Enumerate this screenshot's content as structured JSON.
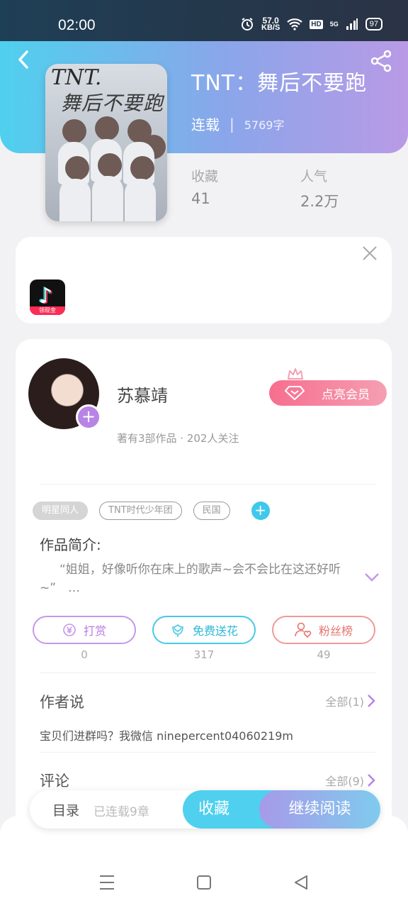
{
  "status_bar": {
    "time": "02:00",
    "speed_value": "57.0",
    "speed_unit": "KB/S",
    "hd": "HD",
    "network": "5G",
    "battery": "97"
  },
  "book": {
    "title": "TNT：舞后不要跑",
    "status": "连载",
    "words": "5769字",
    "cover_text": "TNT.",
    "cover_subtext": "舞后不要跑"
  },
  "stats": {
    "collect_label": "收藏",
    "collect_value": "41",
    "popularity_label": "人气",
    "popularity_value": "2.2万"
  },
  "ad": {
    "app_strip": "领现金"
  },
  "author": {
    "name": "苏慕靖",
    "meta": "著有3部作品 · 202人关注",
    "vip_label": "点亮会员"
  },
  "tags": [
    "明星同人",
    "TNT时代少年团",
    "民国"
  ],
  "intro": {
    "label": "作品简介:",
    "text": "“姐姐，好像听你在床上的歌声~会不会比在这还好听~”　…"
  },
  "actions": [
    {
      "label": "打赏",
      "count": "0"
    },
    {
      "label": "免费送花",
      "count": "317"
    },
    {
      "label": "粉丝榜",
      "count": "49"
    }
  ],
  "author_says": {
    "title": "作者说",
    "all": "全部(1)",
    "text": "宝贝们进群吗？我微信 ninepercent04060219m"
  },
  "comments": {
    "title": "评论",
    "all": "全部(9)"
  },
  "bottom_bar": {
    "toc": "目录",
    "chapters": "已连载9章",
    "collect": "收藏",
    "continue": "继续阅读"
  },
  "colors": {
    "header_start": "#4fd0ee",
    "header_end": "#b99ae6",
    "vip": "#f76e8e",
    "accent_cyan": "#46c9e6",
    "accent_purple": "#b784e6"
  }
}
